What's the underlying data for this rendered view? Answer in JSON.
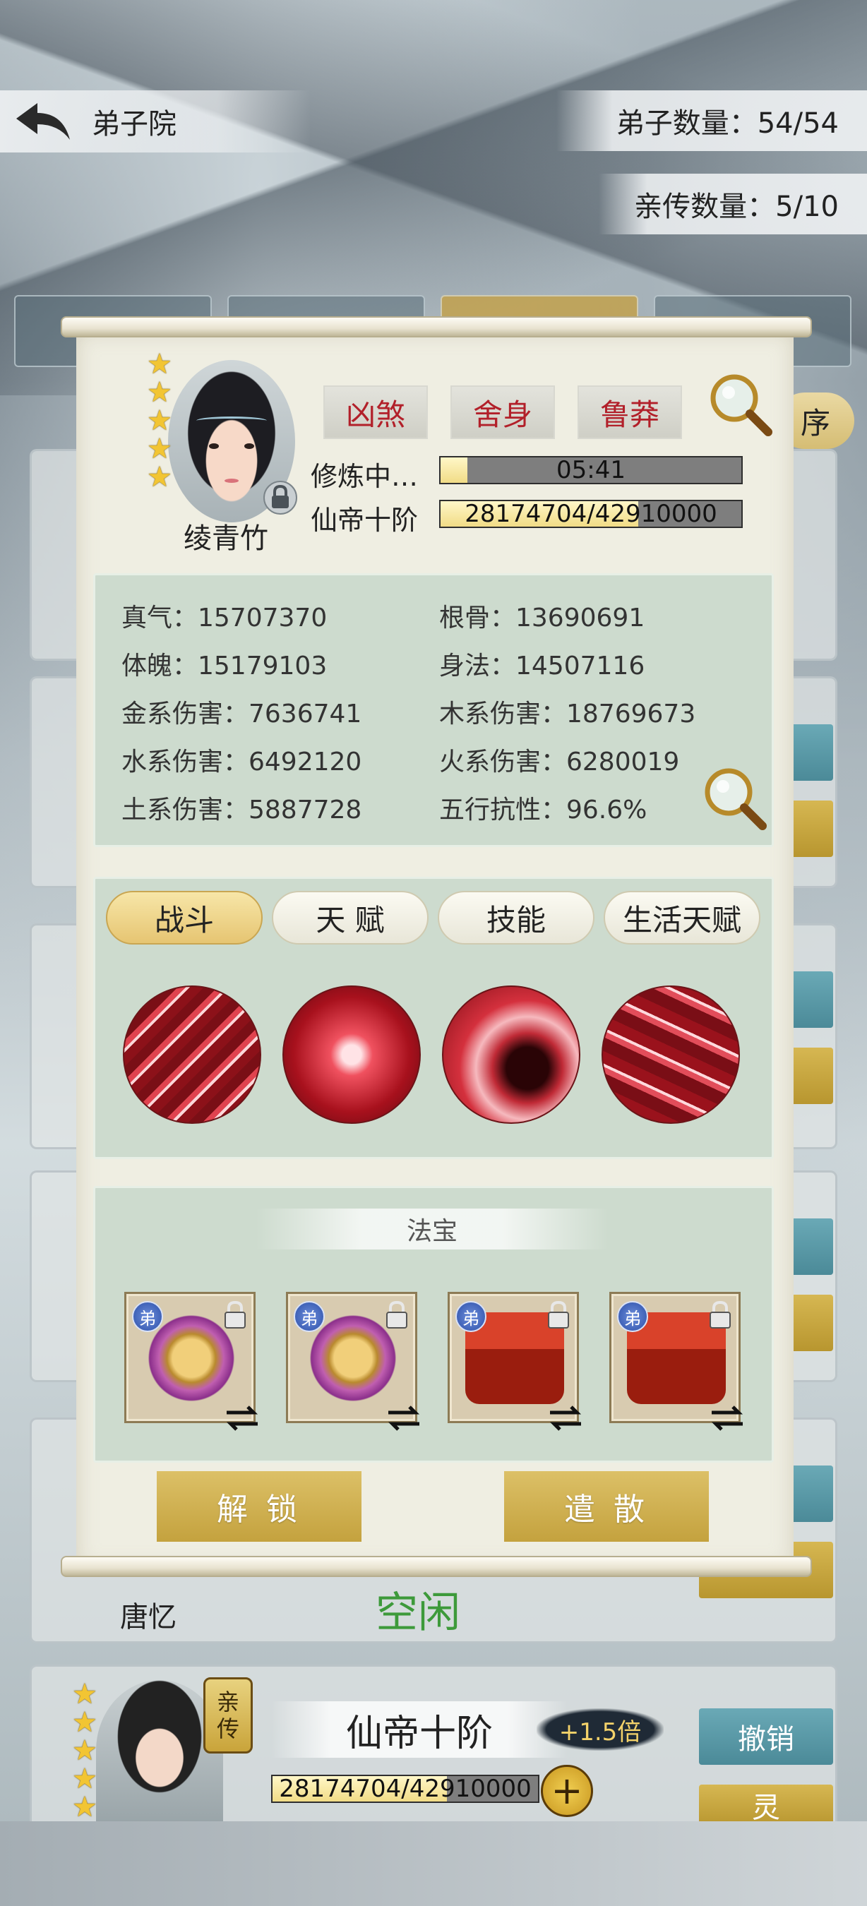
{
  "header": {
    "title": "弟子院",
    "disciple_count": "弟子数量：54/54",
    "direct_disciple_count": "亲传数量：5/10"
  },
  "background_list": {
    "sort_label": "序",
    "idle_card": {
      "name": "唐忆",
      "status": "空闲"
    },
    "bottom_card": {
      "badge": [
        "亲",
        "传"
      ],
      "realm": "仙帝十阶",
      "multiplier": "+1.5倍",
      "progress": {
        "text": "28174704/42910000",
        "fraction": 0.657
      },
      "buttons": [
        "撤销",
        "灵"
      ]
    }
  },
  "dialog": {
    "character": {
      "name": "绫青竹",
      "stars": 5,
      "locked": true
    },
    "traits": [
      "凶煞",
      "舍身",
      "鲁莽"
    ],
    "cultivation": {
      "label": "修炼中…",
      "timer": "05:41",
      "fraction": 0.09
    },
    "realm": {
      "label": "仙帝十阶",
      "exp_text": "28174704/42910000",
      "fraction": 0.657
    },
    "attributes": {
      "left": [
        "真气：15707370",
        "体魄：15179103",
        "金系伤害：7636741",
        "水系伤害：6492120",
        "土系伤害：5887728"
      ],
      "right": [
        "根骨：13690691",
        "身法：14507116",
        "木系伤害：18769673",
        "火系伤害：6280019",
        "五行抗性：96.6%"
      ]
    },
    "skill_tabs": [
      "战斗",
      "天 赋",
      "技能",
      "生活天赋"
    ],
    "active_skill_tab": 0,
    "skills": [
      "claw-slash-skill",
      "spear-thrust-skill",
      "vortex-skill",
      "wind-slash-skill"
    ],
    "treasure": {
      "title": "法宝",
      "badge_text": "弟",
      "items": [
        "medal-item",
        "medal-item",
        "dragon-seal-item",
        "dragon-seal-item"
      ]
    },
    "actions": {
      "unlock": "解 锁",
      "dismiss": "遣 散"
    }
  }
}
